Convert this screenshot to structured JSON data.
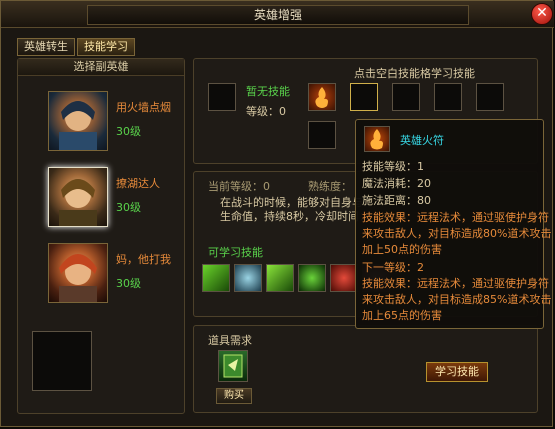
{
  "window": {
    "title": "英雄增强",
    "close_label": "✕"
  },
  "tabs": [
    {
      "label": "英雄转生"
    },
    {
      "label": "技能学习"
    }
  ],
  "hero_list": {
    "header": "选择副英雄",
    "heroes": [
      {
        "name": "用火墙点烟",
        "level": "30级",
        "name_color": "#e68a3a"
      },
      {
        "name": "撩湖达人",
        "level": "30级",
        "name_color": "#e68a3a"
      },
      {
        "name": "妈，他打我",
        "level": "30级",
        "name_color": "#e68a3a"
      }
    ]
  },
  "current_skill": {
    "name": "暂无技能",
    "level_label": "等级",
    "level_value": "0"
  },
  "grid": {
    "header": "点击空白技能格学习技能"
  },
  "info": {
    "current_level_label": "当前等级",
    "current_level_value": "0",
    "mastery_label": "熟练度",
    "description": "在战斗的时候，能够对自身与",
    "description_line2": "生命值，持续8秒，冷却时间："
  },
  "learnable": {
    "header": "可学习技能"
  },
  "items": {
    "header": "道具需求",
    "buy_label": "购买"
  },
  "learn_button": {
    "label": "学习技能"
  },
  "tooltip": {
    "title": "英雄火符",
    "lines": [
      {
        "label": "技能等级",
        "value": "1"
      },
      {
        "label": "魔法消耗",
        "value": "20"
      },
      {
        "label": "施法距离",
        "value": "80"
      }
    ],
    "effect": [
      "技能效果：远程法术，通过驱使护身符",
      "来攻击敌人，对目标造成80%道术攻击",
      "加上50点的伤害"
    ],
    "next_label": "下一等级：2",
    "next_effect": [
      "技能效果：远程法术，通过驱使护身符",
      "来攻击敌人，对目标造成85%道术攻击",
      "加上65点的伤害"
    ]
  },
  "colors": {
    "gold": "#d8c9a3",
    "green": "#59d24b",
    "orange": "#e68a3a",
    "cyan": "#38d8e6"
  }
}
